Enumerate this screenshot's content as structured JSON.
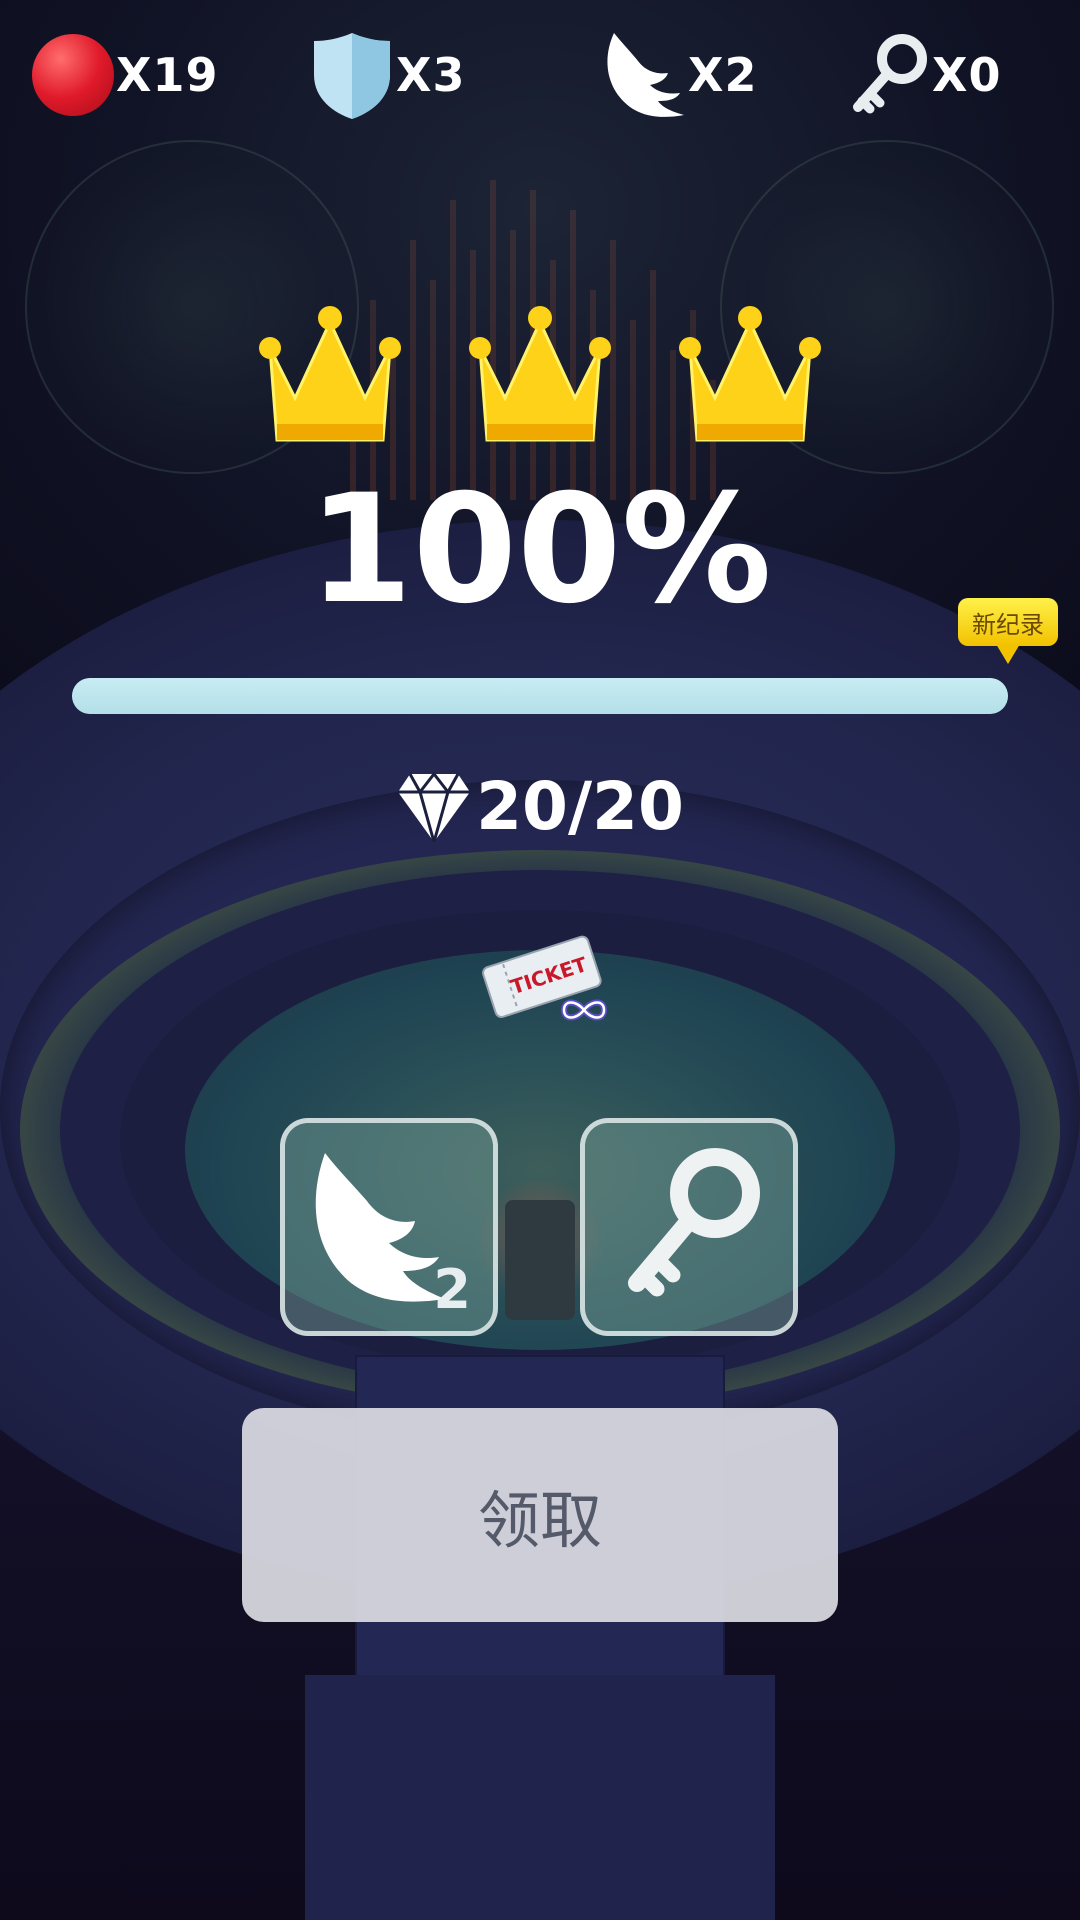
{
  "hud": {
    "balls": {
      "icon": "red-ball-icon",
      "count": "X19"
    },
    "shields": {
      "icon": "shield-icon",
      "count": "X3"
    },
    "wings": {
      "icon": "wing-icon",
      "count": "X2"
    },
    "keys": {
      "icon": "key-icon",
      "count": "X0"
    }
  },
  "result": {
    "crowns": 3,
    "crown_icon": "crown-icon",
    "percent": "100%",
    "progress": 1.0,
    "new_record_label": "新纪录",
    "gems": "20/20",
    "gem_icon": "diamond-icon"
  },
  "ticket": {
    "icon": "infinite-ticket-icon",
    "label": "TICKET"
  },
  "rewards": [
    {
      "icon": "wing-icon",
      "quantity": "2"
    },
    {
      "icon": "key-icon",
      "quantity": ""
    }
  ],
  "claim_button": {
    "label": "领取"
  },
  "colors": {
    "crown": "#ffd21a",
    "progress": "#b4dfe8",
    "record_badge": "#f5d21a",
    "ball": "#e01a2a",
    "shield": "#bfe3f3"
  }
}
